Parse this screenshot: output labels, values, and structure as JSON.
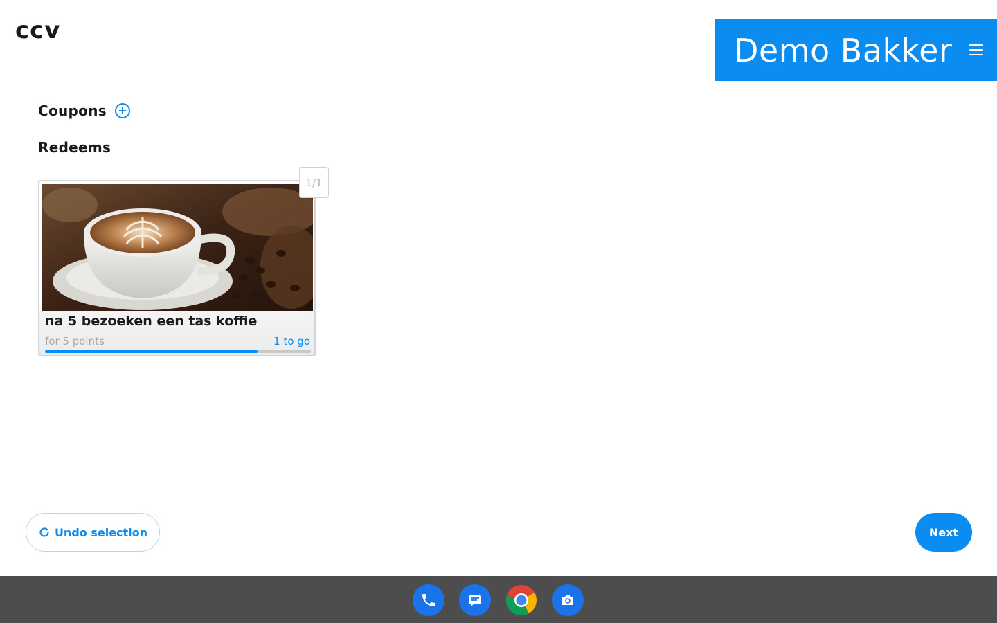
{
  "header": {
    "logo_text": "CCV",
    "merchant_name": "Demo Bakker",
    "menu_icon": "hamburger-menu-icon"
  },
  "sections": {
    "coupons_label": "Coupons",
    "add_icon": "plus-circle-icon",
    "redeems_label": "Redeems"
  },
  "pagination": {
    "label": "1/1"
  },
  "redeem_card": {
    "title": "na 5 bezoeken een tas koffie",
    "points_text": "for 5 points",
    "remaining_text": "1 to go",
    "progress_fraction": 0.8,
    "image": "coffee-latte-art-photo"
  },
  "actions": {
    "undo_label": "Undo selection",
    "undo_icon": "refresh-icon",
    "next_label": "Next"
  },
  "taskbar": {
    "apps": [
      "phone-icon",
      "messages-icon",
      "chrome-icon",
      "camera-icon"
    ]
  },
  "colors": {
    "accent": "#0a8cf0",
    "taskbar": "#4d4d4d",
    "text": "#1a1a1a",
    "muted": "#a8a8a8"
  }
}
